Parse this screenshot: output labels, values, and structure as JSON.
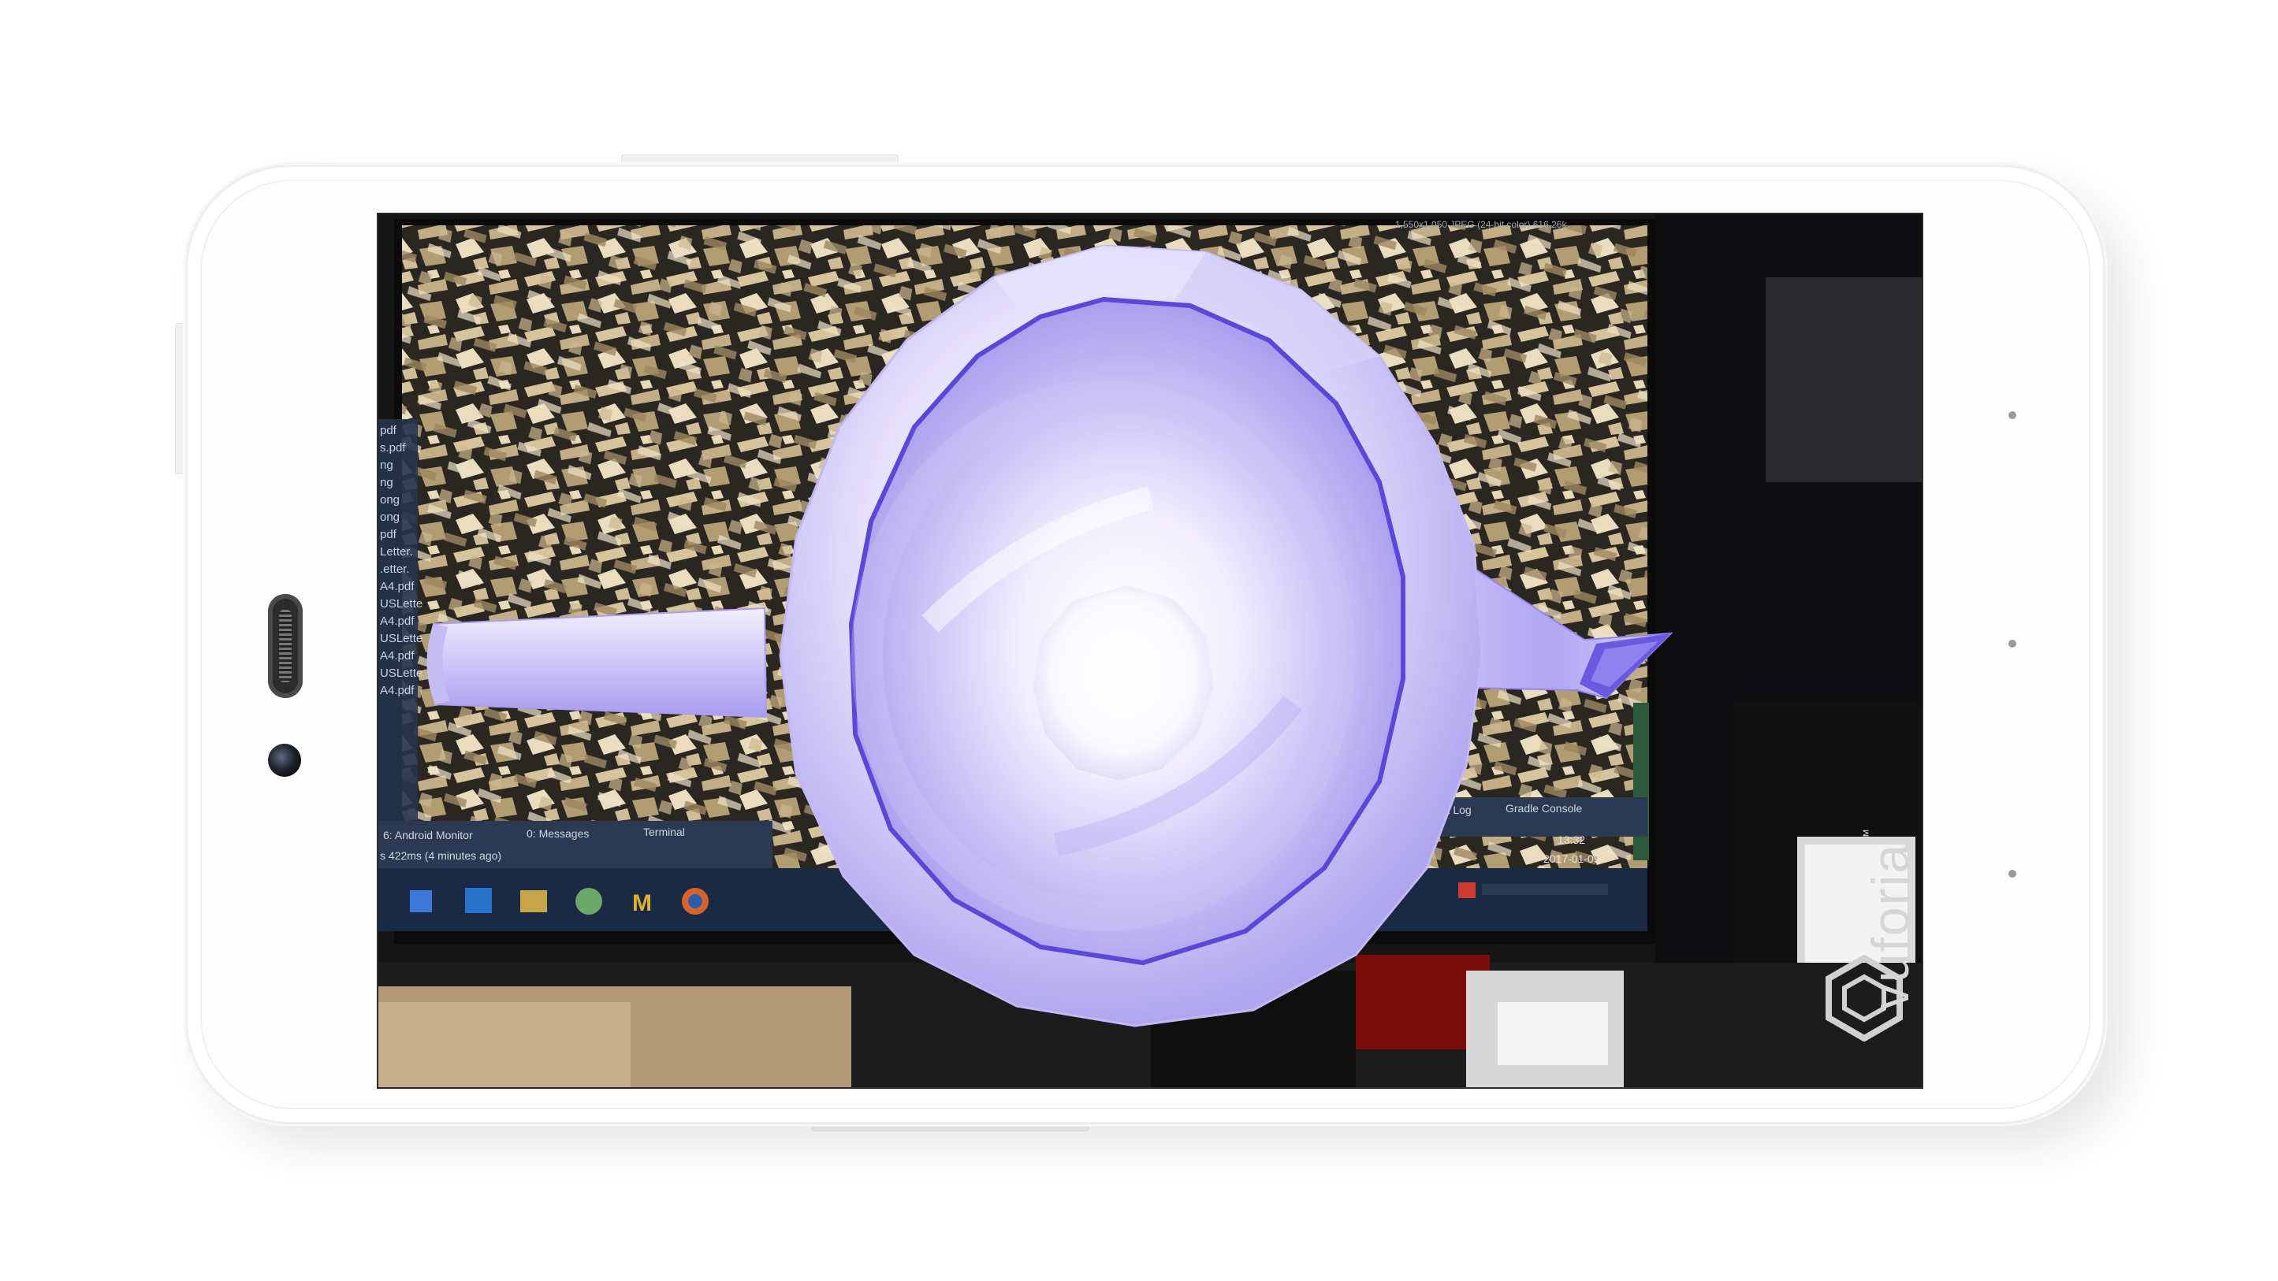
{
  "device": {
    "model_hint": "white-android-phone-landscape"
  },
  "ar_view": {
    "virtual_object": "teapot",
    "object_color": "#a89cf0",
    "object_highlight": "#ffffff",
    "brand_mark_text": "vuforia",
    "brand_mark_suffix": "™"
  },
  "background_monitor": {
    "info_bar": "1,550x1,050 JPEG (24-bit color) 616.26k",
    "file_list": [
      "pdf",
      "s.pdf",
      "ng",
      "ng",
      "ong",
      "ong",
      "pdf",
      "Letter.",
      ".etter.",
      "A4.pdf",
      "USLette",
      "A4.pdf",
      "USLette",
      "A4.pdf",
      "USLette",
      "A4.pdf"
    ],
    "bottom_tabs": {
      "android_monitor": "6: Android Monitor",
      "messages": "0: Messages",
      "terminal": "Terminal",
      "event_log": "ent Log",
      "gradle_console": "Gradle Console"
    },
    "status_text": "s 422ms (4 minutes ago)",
    "clock_time": "13:32",
    "clock_date": "2017-01-09"
  },
  "colors": {
    "teapot_purple": "#9b8ff0",
    "teapot_edge": "#6a5ae0",
    "taskbar_bg": "#1b2a44",
    "ide_bg": "#2b3952"
  }
}
